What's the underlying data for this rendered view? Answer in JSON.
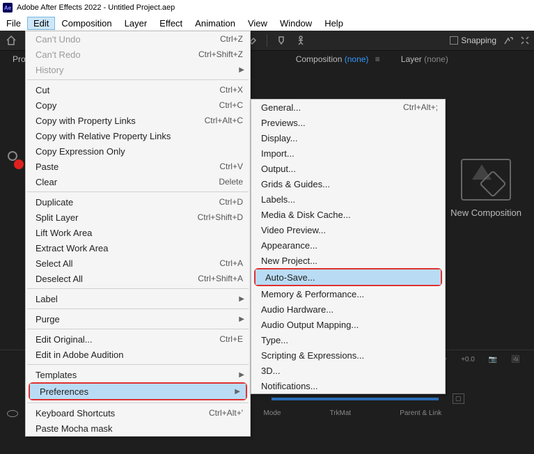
{
  "title": "Adobe After Effects 2022 - Untitled Project.aep",
  "menubar": [
    "File",
    "Edit",
    "Composition",
    "Layer",
    "Effect",
    "Animation",
    "View",
    "Window",
    "Help"
  ],
  "toolbar": {
    "snapping": "Snapping"
  },
  "panels": {
    "project": "Pro",
    "composition_label": "Composition",
    "composition_value": "(none)",
    "layer_label": "Layer",
    "layer_value": "(none)"
  },
  "edit_menu": {
    "undo": {
      "label": "Can't Undo",
      "shortcut": "Ctrl+Z",
      "disabled": true
    },
    "redo": {
      "label": "Can't Redo",
      "shortcut": "Ctrl+Shift+Z",
      "disabled": true
    },
    "history": {
      "label": "History",
      "arrow": true,
      "disabled": true
    },
    "cut": {
      "label": "Cut",
      "shortcut": "Ctrl+X"
    },
    "copy": {
      "label": "Copy",
      "shortcut": "Ctrl+C"
    },
    "copy_pl": {
      "label": "Copy with Property Links",
      "shortcut": "Ctrl+Alt+C"
    },
    "copy_rpl": {
      "label": "Copy with Relative Property Links"
    },
    "copy_expr": {
      "label": "Copy Expression Only"
    },
    "paste": {
      "label": "Paste",
      "shortcut": "Ctrl+V"
    },
    "clear": {
      "label": "Clear",
      "shortcut": "Delete"
    },
    "duplicate": {
      "label": "Duplicate",
      "shortcut": "Ctrl+D"
    },
    "split": {
      "label": "Split Layer",
      "shortcut": "Ctrl+Shift+D"
    },
    "lift": {
      "label": "Lift Work Area"
    },
    "extract": {
      "label": "Extract Work Area"
    },
    "select_all": {
      "label": "Select All",
      "shortcut": "Ctrl+A"
    },
    "deselect": {
      "label": "Deselect All",
      "shortcut": "Ctrl+Shift+A"
    },
    "label": {
      "label": "Label",
      "arrow": true
    },
    "purge": {
      "label": "Purge",
      "arrow": true
    },
    "edit_orig": {
      "label": "Edit Original...",
      "shortcut": "Ctrl+E"
    },
    "edit_aud": {
      "label": "Edit in Adobe Audition"
    },
    "templates": {
      "label": "Templates",
      "arrow": true
    },
    "prefs": {
      "label": "Preferences",
      "arrow": true
    },
    "kbd": {
      "label": "Keyboard Shortcuts",
      "shortcut": "Ctrl+Alt+'"
    },
    "mocha": {
      "label": "Paste Mocha mask"
    }
  },
  "prefs_menu": {
    "general": {
      "label": "General...",
      "shortcut": "Ctrl+Alt+;"
    },
    "previews": {
      "label": "Previews..."
    },
    "display": {
      "label": "Display..."
    },
    "import": {
      "label": "Import..."
    },
    "output": {
      "label": "Output..."
    },
    "grids": {
      "label": "Grids & Guides..."
    },
    "labels": {
      "label": "Labels..."
    },
    "media": {
      "label": "Media & Disk Cache..."
    },
    "video": {
      "label": "Video Preview..."
    },
    "appearance": {
      "label": "Appearance..."
    },
    "newproj": {
      "label": "New Project..."
    },
    "autosave": {
      "label": "Auto-Save..."
    },
    "memory": {
      "label": "Memory & Performance..."
    },
    "audiohw": {
      "label": "Audio Hardware..."
    },
    "audioout": {
      "label": "Audio Output Mapping..."
    },
    "type": {
      "label": "Type..."
    },
    "scripting": {
      "label": "Scripting & Expressions..."
    },
    "threed": {
      "label": "3D..."
    },
    "notif": {
      "label": "Notifications..."
    }
  },
  "newcomp": "New Composition",
  "timeline": {
    "mode": "Mode",
    "trkmat": "TrkMat",
    "parent": "Parent & Link",
    "plus": "+0.0"
  }
}
